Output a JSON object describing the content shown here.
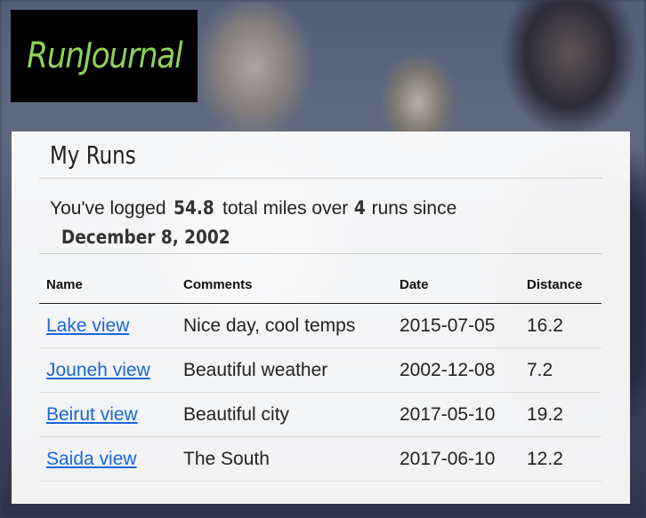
{
  "app": {
    "logo_text": "RunJournal",
    "logo_color": "#8fd15a"
  },
  "card": {
    "title": "My Runs",
    "summary": {
      "prefix": "You've logged",
      "total_miles": "54.8",
      "middle1": "total miles over",
      "runs": "4",
      "middle2": "runs since",
      "since_date": "December 8, 2002"
    }
  },
  "table": {
    "headers": [
      "Name",
      "Comments",
      "Date",
      "Distance"
    ],
    "rows": [
      {
        "name": "Lake view",
        "comments": "Nice day, cool temps",
        "date": "2015-07-05",
        "distance": "16.2"
      },
      {
        "name": "Jouneh view",
        "comments": "Beautiful weather",
        "date": "2002-12-08",
        "distance": "7.2"
      },
      {
        "name": "Beirut view",
        "comments": "Beautiful city",
        "date": "2017-05-10",
        "distance": "19.2"
      },
      {
        "name": "Saida view",
        "comments": "The South",
        "date": "2017-06-10",
        "distance": "12.2"
      }
    ]
  },
  "colors": {
    "link": "#1a66d6",
    "header_border": "#222222"
  }
}
